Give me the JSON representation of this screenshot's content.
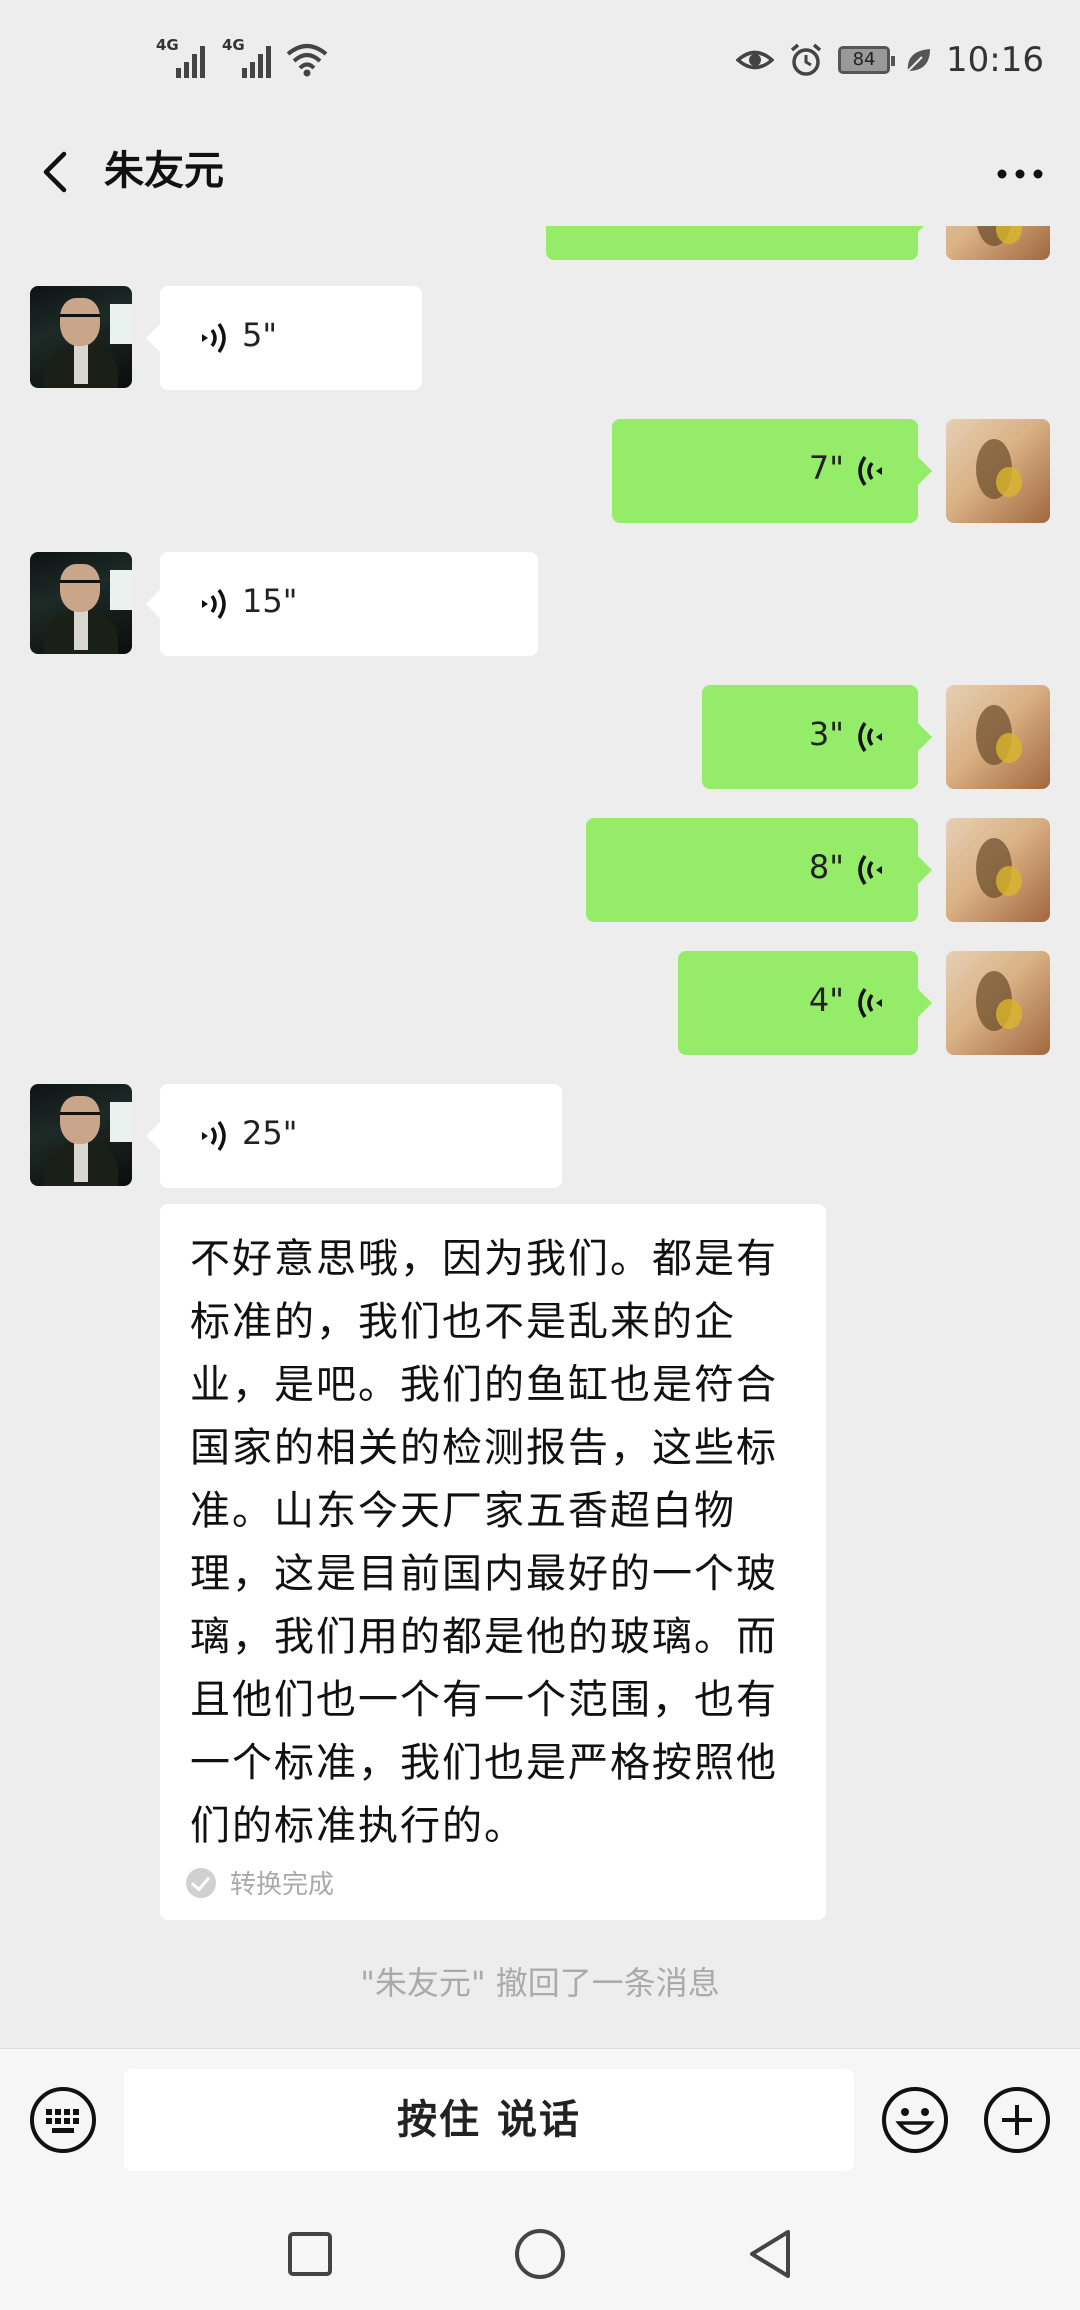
{
  "status_bar": {
    "network_1": "4G",
    "network_2": "4G",
    "battery": "84",
    "time": "10:16",
    "icons": [
      "signal-icon",
      "signal-icon",
      "wifi-icon",
      "eye-icon",
      "alarm-icon",
      "battery-icon",
      "leaf-icon"
    ]
  },
  "header": {
    "back_icon": "chevron-left-icon",
    "title": "朱友元",
    "more_icon": "more-dots-icon"
  },
  "messages": [
    {
      "side": "right",
      "type": "voice",
      "duration": "",
      "partial": true
    },
    {
      "side": "left",
      "type": "voice",
      "duration": "5\""
    },
    {
      "side": "right",
      "type": "voice",
      "duration": "7\""
    },
    {
      "side": "left",
      "type": "voice",
      "duration": "15\""
    },
    {
      "side": "right",
      "type": "voice",
      "duration": "3\""
    },
    {
      "side": "right",
      "type": "voice",
      "duration": "8\""
    },
    {
      "side": "right",
      "type": "voice",
      "duration": "4\""
    },
    {
      "side": "left",
      "type": "voice",
      "duration": "25\""
    }
  ],
  "transcript": {
    "text": "不好意思哦，因为我们。都是有标准的，我们也不是乱来的企业，是吧。我们的鱼缸也是符合国家的相关的检测报告，这些标准。山东今天厂家五香超白物理，这是目前国内最好的一个玻璃，我们用的都是他的玻璃。而且他们也一个有一个范围，也有一个标准，我们也是严格按照他们的标准执行的。",
    "status": "转换完成"
  },
  "system_note": "\"朱友元\" 撤回了一条消息",
  "input_bar": {
    "keyboard_icon": "keyboard-icon",
    "hold_to_talk": "按住 说话",
    "emoji_icon": "emoji-icon",
    "plus_icon": "plus-icon"
  },
  "nav_bar": {
    "icons": [
      "recent-apps-icon",
      "home-icon",
      "back-triangle-icon"
    ]
  },
  "colors": {
    "background": "#ededed",
    "sent_bubble": "#95ec69",
    "received_bubble": "#ffffff",
    "muted_text": "#aaaaaa"
  }
}
